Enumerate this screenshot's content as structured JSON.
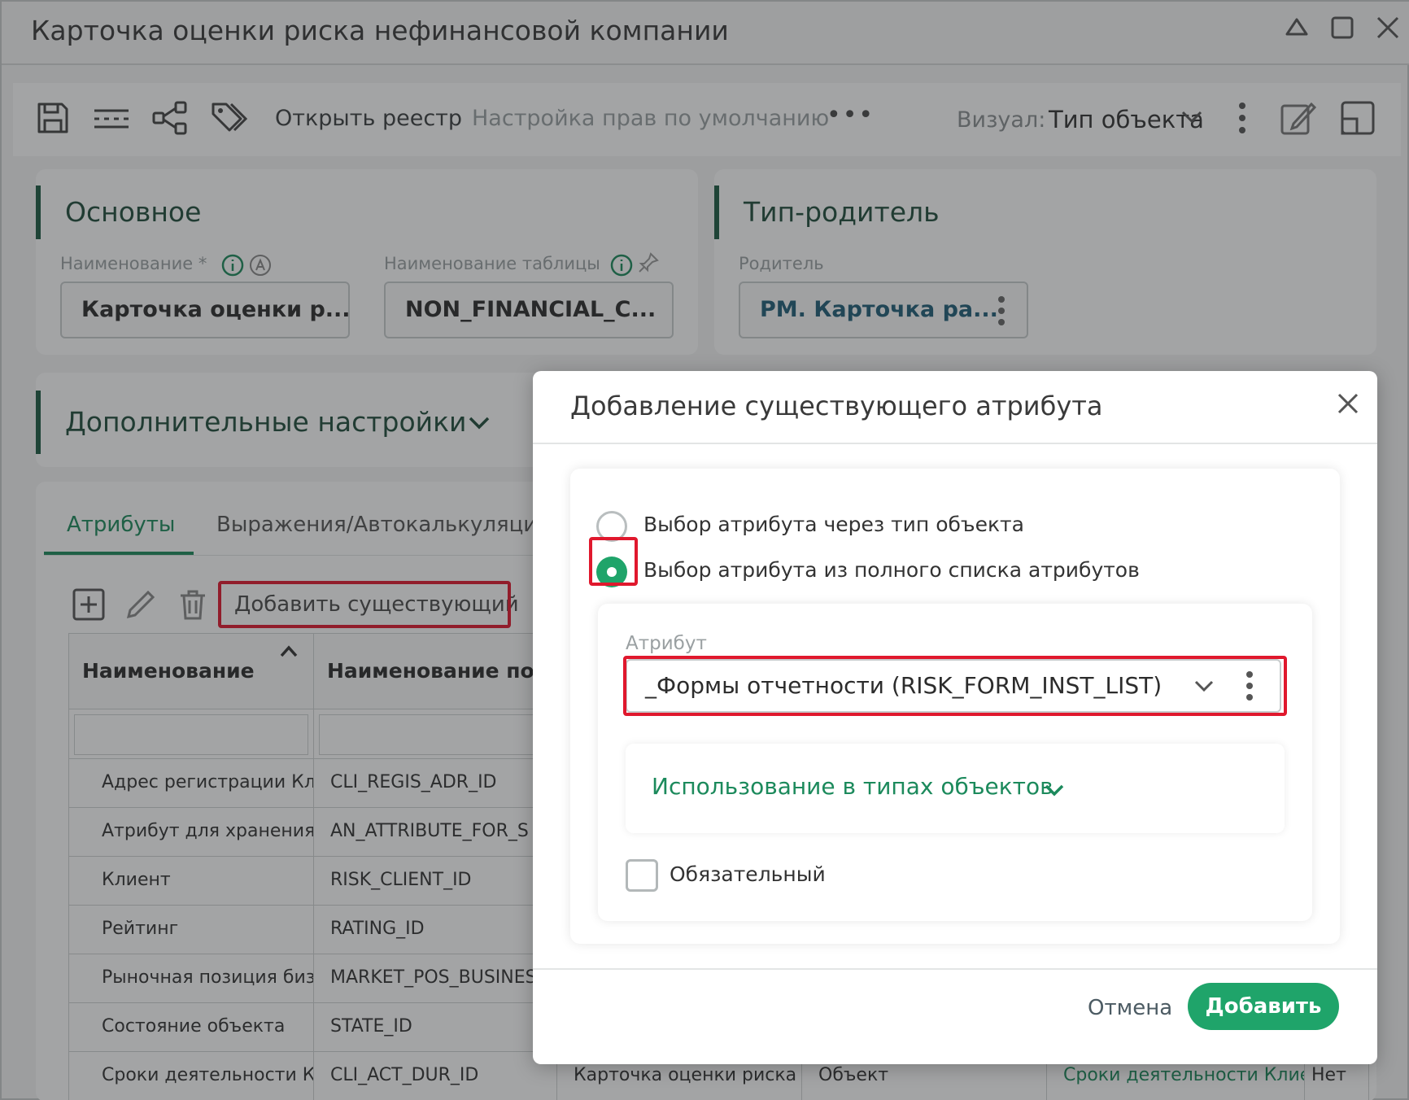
{
  "window": {
    "title": "Карточка оценки риска нефинансовой компании"
  },
  "toolbar": {
    "open_registry": "Открыть реестр",
    "default_rights": "Настройка прав по умолчанию",
    "more": "•••",
    "visual_label": "Визуал:",
    "visual_value": "Тип объекта"
  },
  "main_card": {
    "title": "Основное",
    "name_label": "Наименование *",
    "name_value": "Карточка оценки р...",
    "table_label": "Наименование таблицы",
    "table_value": "NON_FINANCIAL_C..."
  },
  "parent_card": {
    "title": "Тип-родитель",
    "parent_label": "Родитель",
    "parent_value": "РМ. Карточка ра..."
  },
  "extra_settings": {
    "title": "Дополнительные настройки"
  },
  "tabs": [
    {
      "label": "Атрибуты"
    },
    {
      "label": "Выражения/Автокалькуляции"
    }
  ],
  "attr_toolbar": {
    "add_existing": "Добавить существующий"
  },
  "table": {
    "headers": [
      "Наименование",
      "Наименование по..."
    ],
    "rows": [
      {
        "name": "Адрес регистрации Кли",
        "code": "CLI_REGIS_ADR_ID"
      },
      {
        "name": "Атрибут для хранения д",
        "code": "AN_ATTRIBUTE_FOR_S"
      },
      {
        "name": "Клиент",
        "code": "RISK_CLIENT_ID"
      },
      {
        "name": "Рейтинг",
        "code": "RATING_ID"
      },
      {
        "name": "Рыночная позиция бизн",
        "code": "MARKET_POS_BUSINES"
      },
      {
        "name": "Состояние объекта",
        "code": "STATE_ID"
      },
      {
        "name": "Сроки деятельности Кл",
        "code": "CLI_ACT_DUR_ID",
        "c3": "Карточка оценки риска н",
        "c4": "Объект",
        "c5": "Сроки деятельности Клие",
        "c6": "Нет"
      }
    ]
  },
  "dialog": {
    "title": "Добавление существующего атрибута",
    "radio_by_type": "Выбор атрибута через тип объекта",
    "radio_full_list": "Выбор атрибута из полного списка атрибутов",
    "attribute_label": "Атрибут",
    "attribute_value": "_Формы отчетности (RISK_FORM_INST_LIST)",
    "usage": "Использование в типах объектов",
    "required": "Обязательный",
    "cancel": "Отмена",
    "add": "Добавить"
  },
  "colors": {
    "accent": "#1fa46a",
    "highlight": "#e0182d",
    "heading": "#1f4d3c"
  }
}
